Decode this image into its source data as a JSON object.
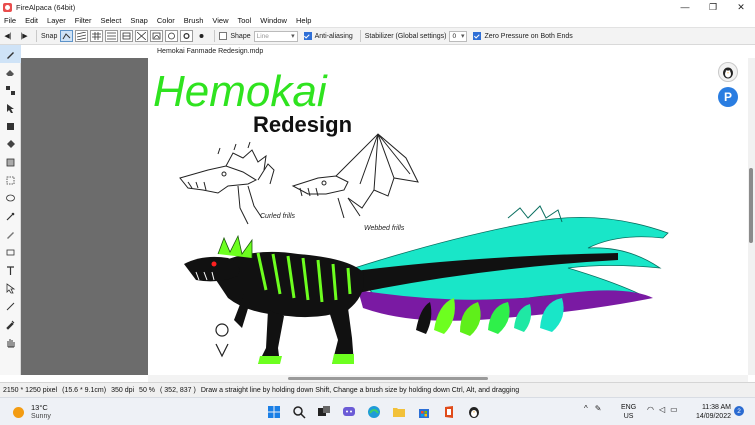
{
  "window": {
    "title": "FireAlpaca (64bit)",
    "controls": {
      "minimize": "—",
      "maximize": "❐",
      "close": "✕"
    }
  },
  "menu": [
    "File",
    "Edit",
    "Layer",
    "Filter",
    "Select",
    "Snap",
    "Color",
    "Brush",
    "View",
    "Tool",
    "Window",
    "Help"
  ],
  "toolbar": {
    "snap_label": "Snap",
    "shape_label": "Shape",
    "shape_value": "Line",
    "antialias_label": "Anti-aliasing",
    "stabilizer_label": "Stabilizer (Global settings)",
    "stabilizer_value": "0",
    "zero_pressure_label": "Zero Pressure on Both Ends"
  },
  "document": {
    "tab_title": "Hemokai Fanmade Redesign.mdp"
  },
  "artwork": {
    "heading": "Hemokai",
    "subheading": "Redesign",
    "note_left": "Curled frills",
    "note_right": "Webbed frills"
  },
  "status": {
    "size_px": "2150 * 1250 pixel",
    "size_cm": "(15.6 * 9.1cm)",
    "dpi": "350 dpi",
    "zoom": "50 %",
    "coords": "( 352, 837 )",
    "hint": "Draw a straight line by holding down Shift, Change a brush size by holding down Ctrl, Alt, and dragging"
  },
  "taskbar": {
    "temp": "13°C",
    "weather": "Sunny",
    "lang_top": "ENG",
    "lang_bottom": "US",
    "time": "11:38 AM",
    "date": "14/09/2022",
    "notifications": "2"
  },
  "colors": {
    "accent": "#2f6fd6",
    "dragon_green": "#6dff1f",
    "dragon_teal": "#19e6c8",
    "dragon_purple": "#7a1aa3",
    "dragon_black": "#111111"
  }
}
